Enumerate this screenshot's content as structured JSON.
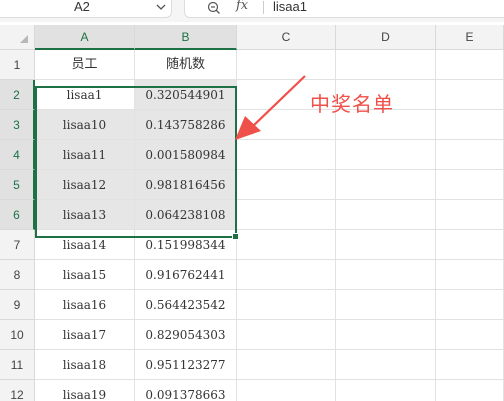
{
  "formula_bar": {
    "cell_ref": "A2",
    "fx_symbol": "fx",
    "content": "lisaa1"
  },
  "columns": [
    "A",
    "B",
    "C",
    "D",
    "E"
  ],
  "rows": [
    "1",
    "2",
    "3",
    "4",
    "5",
    "6",
    "7",
    "8",
    "9",
    "10",
    "11",
    "12"
  ],
  "header_row": {
    "a": "员工",
    "b": "随机数"
  },
  "data_rows": [
    {
      "a": "lisaa1",
      "b": "0.320544901"
    },
    {
      "a": "lisaa10",
      "b": "0.143758286"
    },
    {
      "a": "lisaa11",
      "b": "0.001580984"
    },
    {
      "a": "lisaa12",
      "b": "0.981816456"
    },
    {
      "a": "lisaa13",
      "b": "0.064238108"
    },
    {
      "a": "lisaa14",
      "b": "0.151998344"
    },
    {
      "a": "lisaa15",
      "b": "0.916762441"
    },
    {
      "a": "lisaa16",
      "b": "0.564423542"
    },
    {
      "a": "lisaa17",
      "b": "0.829054303"
    },
    {
      "a": "lisaa18",
      "b": "0.951123277"
    },
    {
      "a": "lisaa19",
      "b": "0.091378663"
    }
  ],
  "annotation": {
    "text": "中奖名单",
    "color": "#f0504a"
  },
  "colors": {
    "selection": "#1e7145",
    "selected_fill": "#e6e6e6",
    "header_bg": "#f3f3f3"
  }
}
